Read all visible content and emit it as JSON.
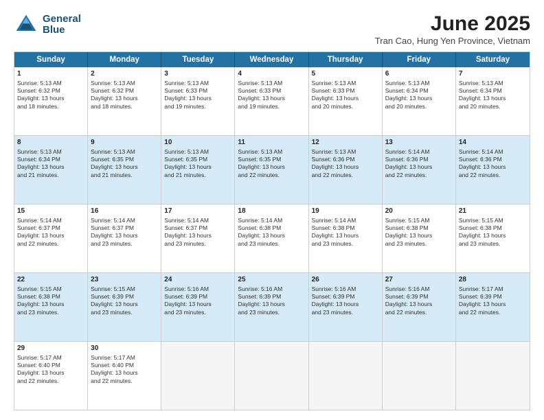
{
  "header": {
    "logo_line1": "General",
    "logo_line2": "Blue",
    "main_title": "June 2025",
    "subtitle": "Tran Cao, Hung Yen Province, Vietnam"
  },
  "weekdays": [
    "Sunday",
    "Monday",
    "Tuesday",
    "Wednesday",
    "Thursday",
    "Friday",
    "Saturday"
  ],
  "rows": [
    [
      {
        "day": "",
        "info": ""
      },
      {
        "day": "2",
        "info": "Sunrise: 5:13 AM\nSunset: 6:32 PM\nDaylight: 13 hours\nand 18 minutes."
      },
      {
        "day": "3",
        "info": "Sunrise: 5:13 AM\nSunset: 6:33 PM\nDaylight: 13 hours\nand 19 minutes."
      },
      {
        "day": "4",
        "info": "Sunrise: 5:13 AM\nSunset: 6:33 PM\nDaylight: 13 hours\nand 19 minutes."
      },
      {
        "day": "5",
        "info": "Sunrise: 5:13 AM\nSunset: 6:33 PM\nDaylight: 13 hours\nand 20 minutes."
      },
      {
        "day": "6",
        "info": "Sunrise: 5:13 AM\nSunset: 6:34 PM\nDaylight: 13 hours\nand 20 minutes."
      },
      {
        "day": "7",
        "info": "Sunrise: 5:13 AM\nSunset: 6:34 PM\nDaylight: 13 hours\nand 20 minutes."
      }
    ],
    [
      {
        "day": "1",
        "info": "Sunrise: 5:13 AM\nSunset: 6:32 PM\nDaylight: 13 hours\nand 18 minutes."
      },
      {
        "day": "",
        "info": ""
      },
      {
        "day": "",
        "info": ""
      },
      {
        "day": "",
        "info": ""
      },
      {
        "day": "",
        "info": ""
      },
      {
        "day": "",
        "info": ""
      },
      {
        "day": "",
        "info": ""
      }
    ],
    [
      {
        "day": "8",
        "info": "Sunrise: 5:13 AM\nSunset: 6:34 PM\nDaylight: 13 hours\nand 21 minutes."
      },
      {
        "day": "9",
        "info": "Sunrise: 5:13 AM\nSunset: 6:35 PM\nDaylight: 13 hours\nand 21 minutes."
      },
      {
        "day": "10",
        "info": "Sunrise: 5:13 AM\nSunset: 6:35 PM\nDaylight: 13 hours\nand 21 minutes."
      },
      {
        "day": "11",
        "info": "Sunrise: 5:13 AM\nSunset: 6:35 PM\nDaylight: 13 hours\nand 22 minutes."
      },
      {
        "day": "12",
        "info": "Sunrise: 5:13 AM\nSunset: 6:36 PM\nDaylight: 13 hours\nand 22 minutes."
      },
      {
        "day": "13",
        "info": "Sunrise: 5:14 AM\nSunset: 6:36 PM\nDaylight: 13 hours\nand 22 minutes."
      },
      {
        "day": "14",
        "info": "Sunrise: 5:14 AM\nSunset: 6:36 PM\nDaylight: 13 hours\nand 22 minutes."
      }
    ],
    [
      {
        "day": "15",
        "info": "Sunrise: 5:14 AM\nSunset: 6:37 PM\nDaylight: 13 hours\nand 22 minutes."
      },
      {
        "day": "16",
        "info": "Sunrise: 5:14 AM\nSunset: 6:37 PM\nDaylight: 13 hours\nand 23 minutes."
      },
      {
        "day": "17",
        "info": "Sunrise: 5:14 AM\nSunset: 6:37 PM\nDaylight: 13 hours\nand 23 minutes."
      },
      {
        "day": "18",
        "info": "Sunrise: 5:14 AM\nSunset: 6:38 PM\nDaylight: 13 hours\nand 23 minutes."
      },
      {
        "day": "19",
        "info": "Sunrise: 5:14 AM\nSunset: 6:38 PM\nDaylight: 13 hours\nand 23 minutes."
      },
      {
        "day": "20",
        "info": "Sunrise: 5:15 AM\nSunset: 6:38 PM\nDaylight: 13 hours\nand 23 minutes."
      },
      {
        "day": "21",
        "info": "Sunrise: 5:15 AM\nSunset: 6:38 PM\nDaylight: 13 hours\nand 23 minutes."
      }
    ],
    [
      {
        "day": "22",
        "info": "Sunrise: 5:15 AM\nSunset: 6:38 PM\nDaylight: 13 hours\nand 23 minutes."
      },
      {
        "day": "23",
        "info": "Sunrise: 5:15 AM\nSunset: 6:39 PM\nDaylight: 13 hours\nand 23 minutes."
      },
      {
        "day": "24",
        "info": "Sunrise: 5:16 AM\nSunset: 6:39 PM\nDaylight: 13 hours\nand 23 minutes."
      },
      {
        "day": "25",
        "info": "Sunrise: 5:16 AM\nSunset: 6:39 PM\nDaylight: 13 hours\nand 23 minutes."
      },
      {
        "day": "26",
        "info": "Sunrise: 5:16 AM\nSunset: 6:39 PM\nDaylight: 13 hours\nand 23 minutes."
      },
      {
        "day": "27",
        "info": "Sunrise: 5:16 AM\nSunset: 6:39 PM\nDaylight: 13 hours\nand 22 minutes."
      },
      {
        "day": "28",
        "info": "Sunrise: 5:17 AM\nSunset: 6:39 PM\nDaylight: 13 hours\nand 22 minutes."
      }
    ],
    [
      {
        "day": "29",
        "info": "Sunrise: 5:17 AM\nSunset: 6:40 PM\nDaylight: 13 hours\nand 22 minutes."
      },
      {
        "day": "30",
        "info": "Sunrise: 5:17 AM\nSunset: 6:40 PM\nDaylight: 13 hours\nand 22 minutes."
      },
      {
        "day": "",
        "info": ""
      },
      {
        "day": "",
        "info": ""
      },
      {
        "day": "",
        "info": ""
      },
      {
        "day": "",
        "info": ""
      },
      {
        "day": "",
        "info": ""
      }
    ]
  ]
}
